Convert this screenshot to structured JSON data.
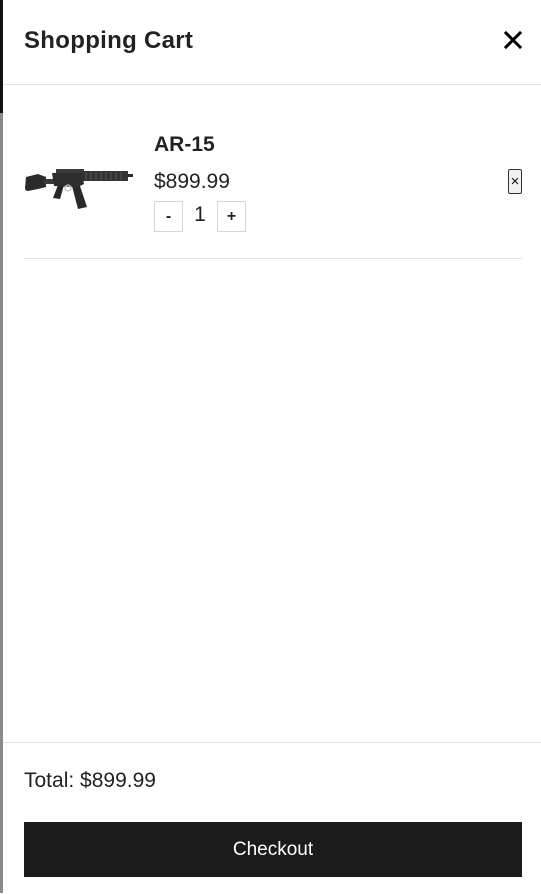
{
  "header": {
    "title": "Shopping Cart",
    "close_icon": "close-icon"
  },
  "cart": {
    "items": [
      {
        "name": "AR-15",
        "price": "$899.99",
        "quantity": "1",
        "decrement_label": "-",
        "increment_label": "+",
        "remove_label": "×",
        "thumbnail_icon": "rifle-image"
      }
    ]
  },
  "footer": {
    "total_text": "Total: $899.99",
    "checkout_label": "Checkout"
  },
  "colors": {
    "checkout_background": "#1b1b1b",
    "divider": "#e3e3e3",
    "text": "#222222"
  }
}
